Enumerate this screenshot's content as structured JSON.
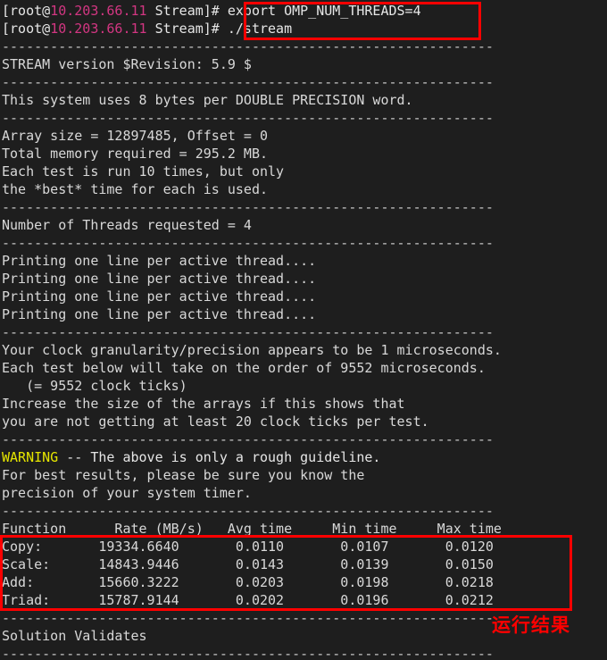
{
  "terminal": {
    "background_color": "#1e1e1e",
    "foreground_color": "#d8d8d8",
    "prompt": {
      "user_host_prefix": "[root@",
      "ip": "10.203.66.11",
      "ip_color": "#d33682",
      "dir_and_sigil": " Stream]# "
    },
    "commands": [
      "export OMP_NUM_THREADS=4",
      "./stream"
    ],
    "separator": "-------------------------------------------------------------",
    "lines": [
      "STREAM version $Revision: 5.9 $",
      "This system uses 8 bytes per DOUBLE PRECISION word.",
      "Array size = 12897485, Offset = 0",
      "Total memory required = 295.2 MB.",
      "Each test is run 10 times, but only",
      "the *best* time for each is used.",
      "Number of Threads requested = 4",
      "Printing one line per active thread....",
      "Printing one line per active thread....",
      "Printing one line per active thread....",
      "Printing one line per active thread....",
      "Your clock granularity/precision appears to be 1 microseconds.",
      "Each test below will take on the order of 9552 microseconds.",
      "   (= 9552 clock ticks)",
      "Increase the size of the arrays if this shows that",
      "you are not getting at least 20 clock ticks per test.",
      "For best results, please be sure you know the",
      "precision of your system timer.",
      "Solution Validates"
    ],
    "warning_label": "WARNING",
    "warning_color": "#e6e600",
    "warning_rest": " -- The above is only a rough guideline.",
    "results_table": {
      "header": "Function      Rate (MB/s)   Avg time     Min time     Max time",
      "columns": [
        "Function",
        "Rate (MB/s)",
        "Avg time",
        "Min time",
        "Max time"
      ],
      "rows": [
        {
          "raw": "Copy:       19334.6640       0.0110       0.0107       0.0120",
          "function": "Copy:",
          "rate": "19334.6640",
          "avg_time": "0.0110",
          "min_time": "0.0107",
          "max_time": "0.0120"
        },
        {
          "raw": "Scale:      14843.9446       0.0143       0.0139       0.0150",
          "function": "Scale:",
          "rate": "14843.9446",
          "avg_time": "0.0143",
          "min_time": "0.0139",
          "max_time": "0.0150"
        },
        {
          "raw": "Add:        15660.3222       0.0203       0.0198       0.0218",
          "function": "Add:",
          "rate": "15660.3222",
          "avg_time": "0.0203",
          "min_time": "0.0198",
          "max_time": "0.0218"
        },
        {
          "raw": "Triad:      15787.9144       0.0202       0.0196       0.0212",
          "function": "Triad:",
          "rate": "15787.9144",
          "avg_time": "0.0202",
          "min_time": "0.0196",
          "max_time": "0.0212"
        }
      ]
    }
  },
  "annotations": {
    "highlight_color": "#ff0000",
    "label_cn": "运行结果"
  }
}
